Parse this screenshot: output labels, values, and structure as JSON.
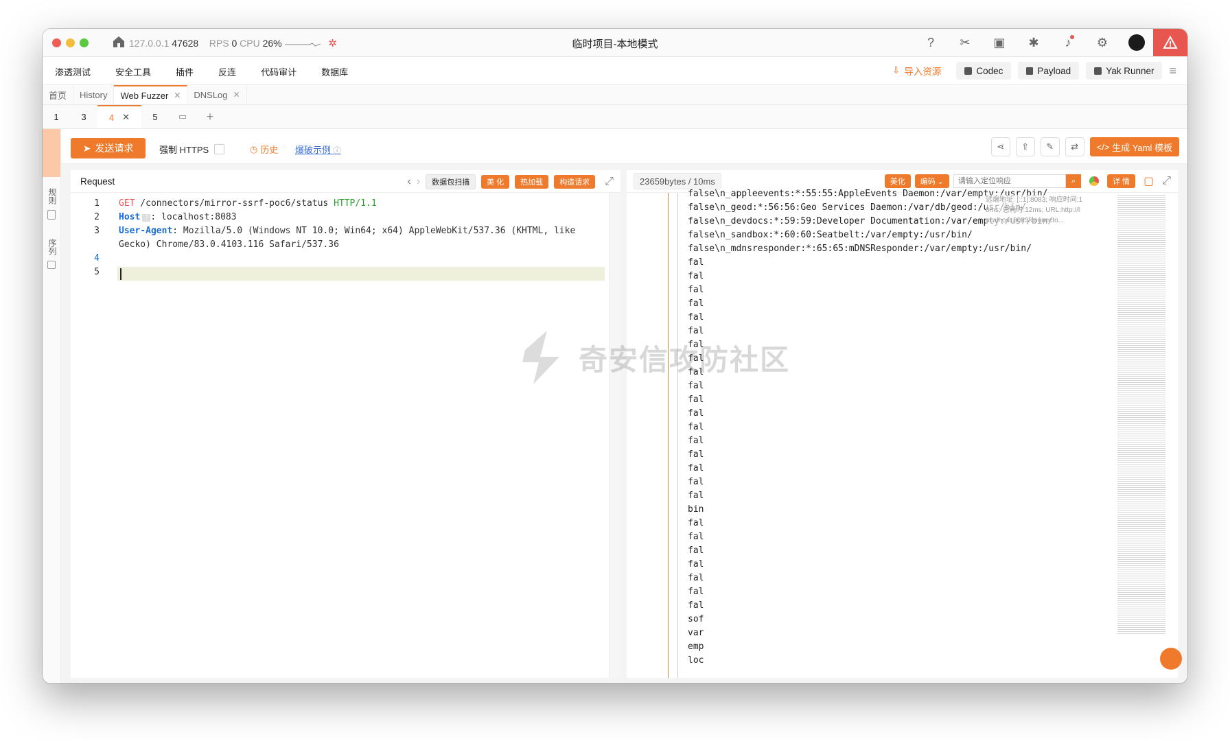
{
  "window": {
    "title": "临时项目-本地模式",
    "ip": "127.0.0.1",
    "port": "47628",
    "rps_label": "RPS",
    "rps_value": "0",
    "cpu_label": "CPU",
    "cpu_value": "26%"
  },
  "menu": [
    "渗透测试",
    "安全工具",
    "插件",
    "反连",
    "代码审计",
    "数据库"
  ],
  "right_tools": {
    "import": "导入资源",
    "codec": "Codec",
    "payload": "Payload",
    "runner": "Yak Runner"
  },
  "tabs": [
    {
      "label": "首页"
    },
    {
      "label": "History"
    },
    {
      "label": "Web Fuzzer",
      "closable": true
    },
    {
      "label": "DNSLog",
      "closable": true
    }
  ],
  "subtabs": [
    "1",
    "3",
    "4",
    "5"
  ],
  "sidebar": {
    "rules": "规则",
    "sequence": "序列"
  },
  "actionbar": {
    "send": "发送请求",
    "force_https": "强制 HTTPS",
    "history": "历史",
    "example": "爆破示例",
    "yaml": "生成 Yaml 模板"
  },
  "request": {
    "title": "Request",
    "scan": "数据包扫描",
    "beautify": "美 化",
    "hotload": "热加载",
    "build": "构造请求",
    "lines": [
      {
        "n": "1",
        "method": "GET",
        "path": " /connectors/mirror-ssrf-poc6/status ",
        "version": "HTTP/1.1"
      },
      {
        "n": "2",
        "header": "Host",
        "marker": "?",
        "value": ": localhost:8083"
      },
      {
        "n": "3",
        "header": "User-Agent",
        "value": ": Mozilla/5.0 (Windows NT 10.0; Win64; x64) AppleWebKit/537.36 (KHTML, like"
      },
      {
        "n": "",
        "value": "Gecko) Chrome/83.0.4103.116 Safari/537.36"
      },
      {
        "n": "4",
        "value": ""
      },
      {
        "n": "5",
        "value": ""
      }
    ]
  },
  "response": {
    "size": "23659bytes / 10ms",
    "beautify": "美化",
    "encode": "编码",
    "search_placeholder": "请输入定位响应",
    "details": "详 情",
    "tooltip_1": "远端地址: [::1]:8083; 响应时间:1",
    "tooltip_2": "0ms; 总耗时:12ms; URL:http://l",
    "tooltip_3": "ocalhost:8083/connecto...",
    "lines": [
      "false\\n_appleevents:*:55:55:AppleEvents Daemon:/var/empty:/usr/bin/",
      "false\\n_geod:*:56:56:Geo Services Daemon:/var/db/geod:/usr/bin/",
      "false\\n_devdocs:*:59:59:Developer Documentation:/var/empty:/usr/bin/",
      "false\\n_sandbox:*:60:60:Seatbelt:/var/empty:/usr/bin/",
      "false\\n_mdnsresponder:*:65:65:mDNSResponder:/var/empty:/usr/bin/",
      "fal",
      "fal",
      "fal",
      "fal",
      "fal",
      "fal",
      "fal",
      "fal",
      "fal",
      "fal",
      "fal",
      "fal",
      "fal",
      "fal",
      "fal",
      "fal",
      "fal",
      "fal",
      "bin",
      "fal",
      "fal",
      "fal",
      "fal",
      "fal",
      "fal",
      "fal",
      "sof",
      "var",
      "emp",
      "loc"
    ]
  },
  "watermark": "奇安信攻防社区",
  "colors": {
    "accent": "#f07a2b",
    "danger": "#e8574f",
    "link": "#3a6fd6"
  }
}
